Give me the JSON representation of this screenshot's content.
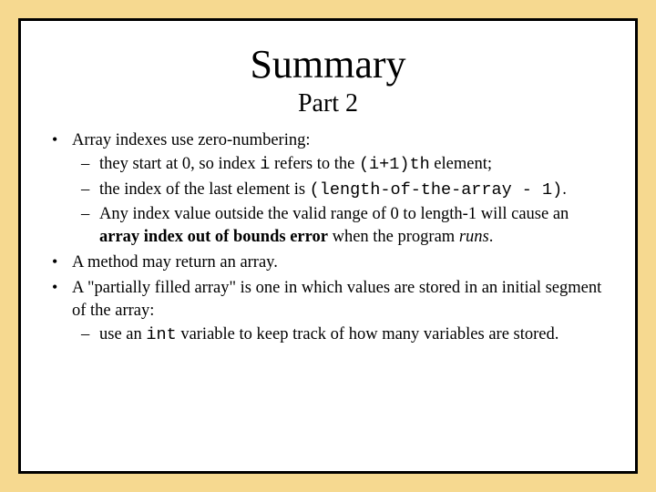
{
  "title": "Summary",
  "subtitle": "Part 2",
  "b1": {
    "lead": "Array indexes use zero-numbering:",
    "s1": {
      "a": "they start at 0, so index ",
      "code_i": "i",
      "b": " refers to the ",
      "code_expr": "(i+1)th",
      "c": " element;"
    },
    "s2": {
      "a": "the index of the last element is ",
      "code_expr": "(length-of-the-array - 1)",
      "b": "."
    },
    "s3": {
      "a": "Any index value outside the valid range of 0 to length-1 will cause an ",
      "bold": "array index out of bounds error",
      "b": " when the program ",
      "ital": "runs",
      "c": "."
    }
  },
  "b2": "A method may return an array.",
  "b3": {
    "lead": "A \"partially filled array\" is one in which values are stored in an initial segment of the array:",
    "s1": {
      "a": "use an ",
      "code": "int",
      "b": " variable to keep track of how many variables are stored."
    }
  }
}
